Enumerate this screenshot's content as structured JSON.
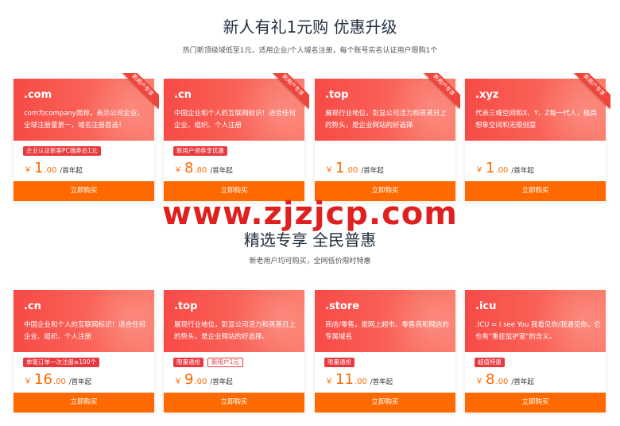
{
  "sections": [
    {
      "title": "新人有礼1元购 优惠升级",
      "subtitle": "热门新顶级域低至1元，适用企业/个人域名注册，每个账号实名认证用户限购1个",
      "cards": [
        {
          "tld": ".com",
          "desc": "com为company简称，表示公司企业，全球注册量第一，域名注册首选！",
          "ribbon": "新用户专享",
          "badges": [
            {
              "text": "企业认证新客PC端券后1元",
              "style": "solid"
            }
          ],
          "price_int": "1",
          "price_dec": ".00",
          "currency": "￥",
          "unit": "/首年起",
          "buy_label": "立即购买"
        },
        {
          "tld": ".cn",
          "desc": "中国企业和个人的互联网标识！适合任何企业、组织、个人注册",
          "ribbon": "新用户专享",
          "badges": [
            {
              "text": "新用户领券享优惠",
              "style": "solid"
            }
          ],
          "price_int": "8",
          "price_dec": ".80",
          "currency": "￥",
          "unit": "/首年起",
          "buy_label": "立即购买"
        },
        {
          "tld": ".top",
          "desc": "展现行业地位，彰显公司活力和蒸蒸日上的势头，是企业网站的好选择",
          "ribbon": "新用户专享",
          "badges": [],
          "price_int": "1",
          "price_dec": ".00",
          "currency": "￥",
          "unit": "/首年起",
          "buy_label": "立即购买"
        },
        {
          "tld": ".xyz",
          "desc": "代表三维空间和X、Y、Z每一代人，极具想象空间和无限创意",
          "ribbon": "新用户专享",
          "badges": [],
          "price_int": "1",
          "price_dec": ".00",
          "currency": "￥",
          "unit": "/首年起",
          "buy_label": "立即购买"
        }
      ]
    },
    {
      "title": "精选专享 全民普惠",
      "subtitle": "新老用户均可购买，全网低价限时特惠",
      "cards": [
        {
          "tld": ".cn",
          "desc": "中国企业和个人的互联网标识！适合任何企业、组织、个人注册",
          "ribbon": "",
          "badges": [
            {
              "text": "单笔订单一次注册≥100个",
              "style": "solid"
            }
          ],
          "price_int": "16",
          "price_dec": ".00",
          "currency": "￥",
          "unit": "/首年起",
          "buy_label": "立即购买"
        },
        {
          "tld": ".top",
          "desc": "展现行业地位，彰显公司活力和蒸蒸日上的势头，是企业网站的好选择。",
          "ribbon": "",
          "badges": [
            {
              "text": "限量通抢",
              "style": "solid"
            },
            {
              "text": "新用户1元",
              "style": "outline"
            }
          ],
          "price_int": "9",
          "price_dec": ".00",
          "currency": "￥",
          "unit": "/首年起",
          "buy_label": "立即购买"
        },
        {
          "tld": ".store",
          "desc": "商店/零售，是网上超市、零售商和网店的专属域名",
          "ribbon": "",
          "badges": [
            {
              "text": "限量通抢",
              "style": "solid"
            }
          ],
          "price_int": "11",
          "price_dec": ".00",
          "currency": "￥",
          "unit": "/首年起",
          "buy_label": "立即购买"
        },
        {
          "tld": ".icu",
          "desc": ".ICU = I see You 我看见你/我遇见你。它也有\"重症监护室\"的含义。",
          "ribbon": "",
          "badges": [
            {
              "text": "超值特惠",
              "style": "solid"
            }
          ],
          "price_int": "8",
          "price_dec": ".00",
          "currency": "￥",
          "unit": "/首年起",
          "buy_label": "立即购买"
        }
      ]
    }
  ],
  "watermark": "www.zjzjcp.com",
  "colors": {
    "accent": "#ff6a00",
    "card_gradient_start": "#f74a46",
    "card_gradient_end": "#fb7868",
    "badge": "#e8383d"
  }
}
